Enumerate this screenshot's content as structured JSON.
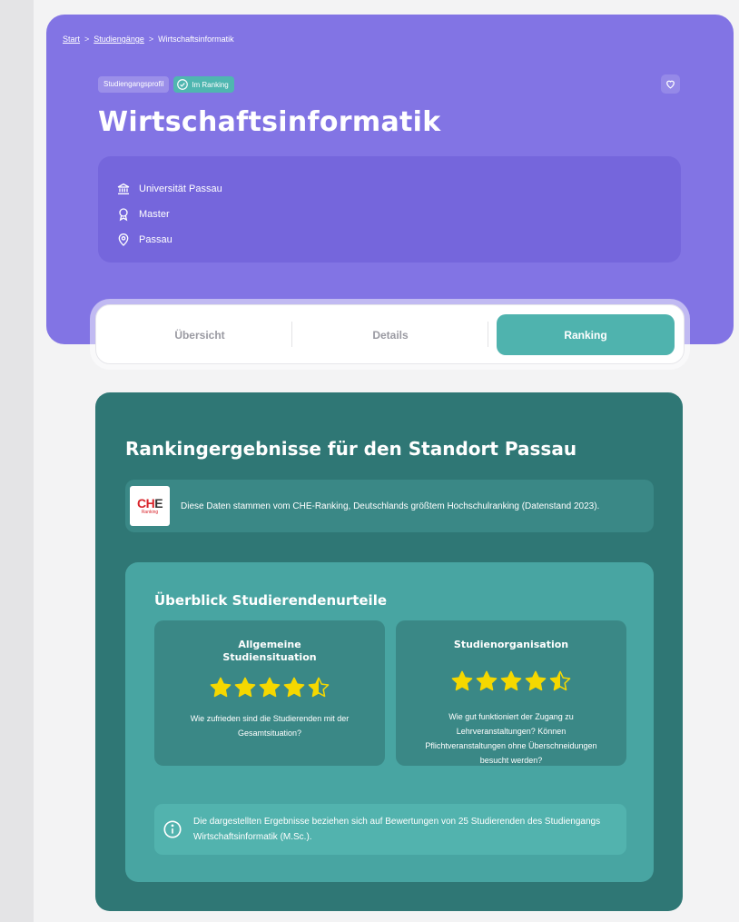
{
  "breadcrumb": {
    "start": "Start",
    "sep1": ">",
    "courses": "Studiengänge",
    "sep2": ">",
    "current": "Wirtschaftsinformatik"
  },
  "badges": {
    "profile": "Studiengangsprofil",
    "ranking": "Im Ranking"
  },
  "title": "Wirtschaftsinformatik",
  "info": {
    "university": "Universität Passau",
    "degree": "Master",
    "location": "Passau"
  },
  "tabs": [
    {
      "label": "Übersicht",
      "active": false
    },
    {
      "label": "Details",
      "active": false
    },
    {
      "label": "Ranking",
      "active": true
    }
  ],
  "ranking": {
    "title": "Rankingergebnisse für den Standort Passau",
    "che_logo": {
      "text_red": "CH",
      "text_dark": "E",
      "sub": "Ranking"
    },
    "che_text": "Diese Daten stammen vom CHE-Ranking, Deutschlands größtem Hochschulranking (Datenstand 2023).",
    "overview_title": "Überblick Studierendenurteile",
    "cards": [
      {
        "title": "Allgemeine Studiensituation",
        "rating": 4.5,
        "max": 5,
        "description": "Wie zufrieden sind die Studierenden mit der Gesamtsituation?"
      },
      {
        "title": "Studienorganisation",
        "rating": 4.5,
        "max": 5,
        "description": "Wie gut funktioniert der Zugang zu Lehrveranstaltungen? Können Pflichtveranstaltungen ohne Überschneidungen besucht werden?"
      }
    ],
    "note": "Die dargestellten Ergebnisse beziehen sich auf Bewertungen von 25 Studierenden des Studiengangs Wirtschaftsinformatik (M.Sc.)."
  },
  "colors": {
    "hero": "#8274e4",
    "info_box": "#7566dc",
    "accent_teal": "#4fb3ae",
    "panel": "#2f7775",
    "star": "#f5d800"
  },
  "icons": {
    "ranking_badge": "check-badge-icon",
    "favorite": "heart-icon",
    "university": "building-columns-icon",
    "degree": "award-ribbon-icon",
    "location": "map-pin-icon",
    "note": "info-circle-icon",
    "rating": "star-icon"
  }
}
